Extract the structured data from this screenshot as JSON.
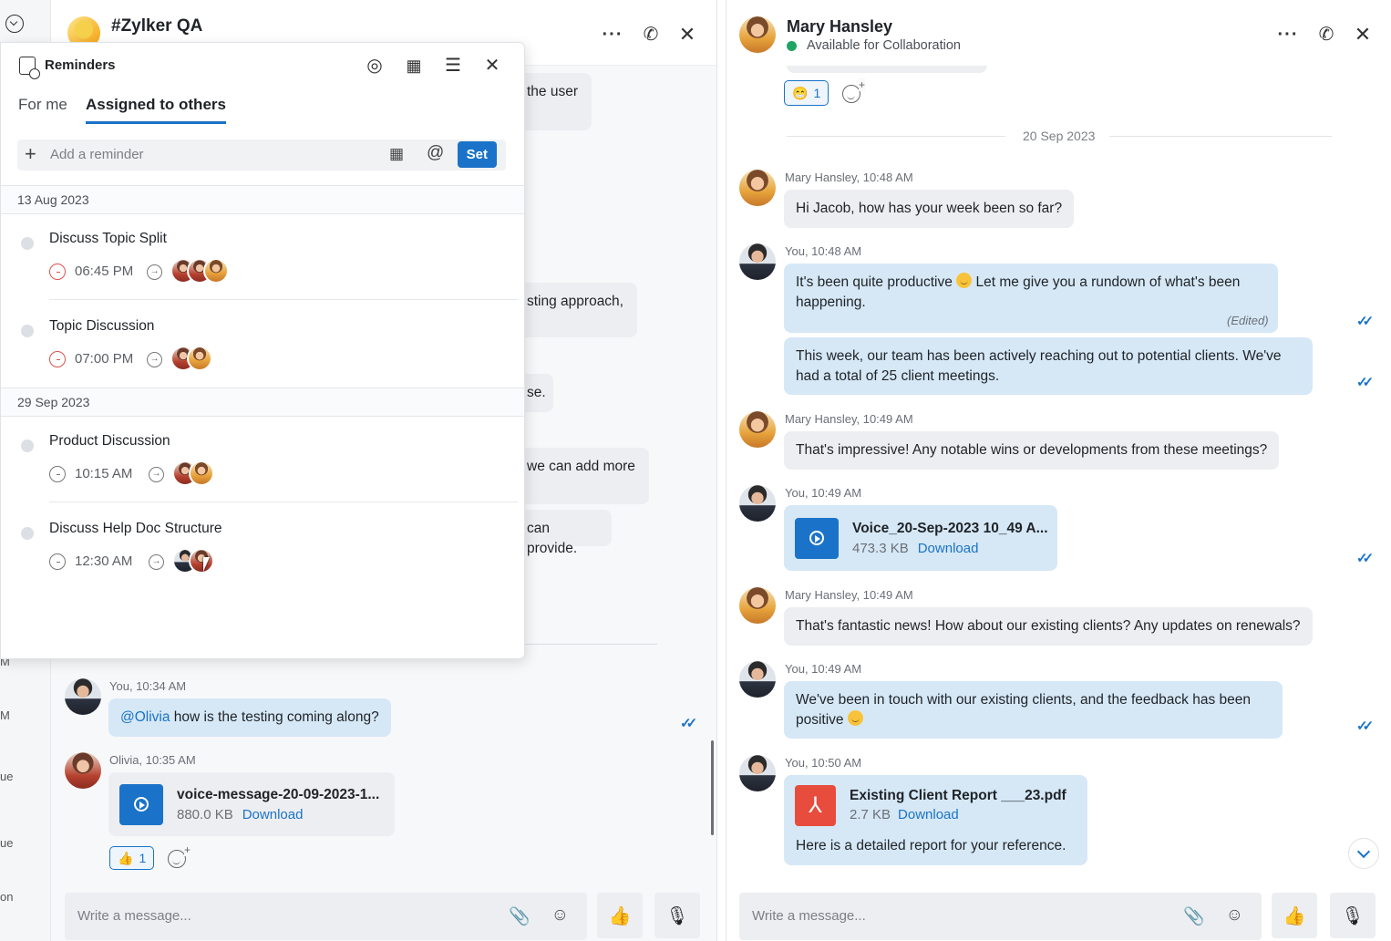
{
  "left_strip": {
    "edge_labels": [
      "M",
      "M",
      "ue",
      "ue",
      "on"
    ]
  },
  "group_chat": {
    "title": "#Zylker QA",
    "partial_bubbles": [
      "the user",
      "sting approach,",
      "se.",
      "we can add more",
      "can provide."
    ],
    "messages": [
      {
        "meta": "You, 10:34 AM",
        "mention": "@Olivia",
        "text": " how is the testing coming along?"
      },
      {
        "meta": "Olivia, 10:35 AM",
        "file_name": "voice-message-20-09-2023-1...",
        "file_size": "880.0 KB",
        "download": "Download",
        "reaction": "👍",
        "reaction_count": "1"
      }
    ],
    "composer_placeholder": "Write a message..."
  },
  "reminders": {
    "title": "Reminders",
    "tabs": [
      "For me",
      "Assigned to others"
    ],
    "active_tab": "Assigned to others",
    "add_placeholder": "Add a reminder",
    "set_label": "Set",
    "groups": [
      {
        "date": "13 Aug 2023",
        "tasks": [
          {
            "title": "Discuss Topic Split",
            "time": "06:45 PM",
            "overdue": true,
            "assignees": 3
          },
          {
            "title": "Topic Discussion",
            "time": "07:00 PM",
            "overdue": true,
            "assignees": 2
          }
        ]
      },
      {
        "date": "29 Sep 2023",
        "tasks": [
          {
            "title": "Product Discussion",
            "time": "10:15 AM",
            "overdue": false,
            "assignees": 2
          },
          {
            "title": "Discuss Help Doc Structure",
            "time": "12:30 AM",
            "overdue": false,
            "assignees": 2
          }
        ]
      }
    ]
  },
  "direct_chat": {
    "name": "Mary Hansley",
    "status": "Available for Collaboration",
    "top_reaction": "😁",
    "top_reaction_count": "1",
    "day_label": "20 Sep 2023",
    "messages": [
      {
        "meta": "Mary Hansley, 10:48 AM",
        "text": "Hi Jacob, how has your week been so far?"
      },
      {
        "meta": "You, 10:48 AM",
        "text_a": "It's been quite productive ",
        "text_b": " Let me give you a rundown of what's been happening.",
        "edited": "(Edited)"
      },
      {
        "text": "This week, our team has been actively reaching out to potential clients. We've had a total of 25 client meetings."
      },
      {
        "meta": "Mary Hansley, 10:49 AM",
        "text": "That's impressive! Any notable wins or developments from these meetings?"
      },
      {
        "meta": "You, 10:49 AM",
        "file_name": "Voice_20-Sep-2023 10_49 A...",
        "file_size": "473.3 KB",
        "download": "Download"
      },
      {
        "meta": "Mary Hansley, 10:49 AM",
        "text": "That's fantastic news! How about our existing clients? Any updates on renewals?"
      },
      {
        "meta": "You, 10:49 AM",
        "text": "We've been in touch with our existing clients, and the feedback has been positive "
      },
      {
        "meta": "You, 10:50 AM",
        "file_name": "Existing Client Report ___23.pdf",
        "file_size": "2.7 KB",
        "download": "Download",
        "caption": "Here is a detailed report for your reference."
      }
    ],
    "composer_placeholder": "Write a message..."
  }
}
